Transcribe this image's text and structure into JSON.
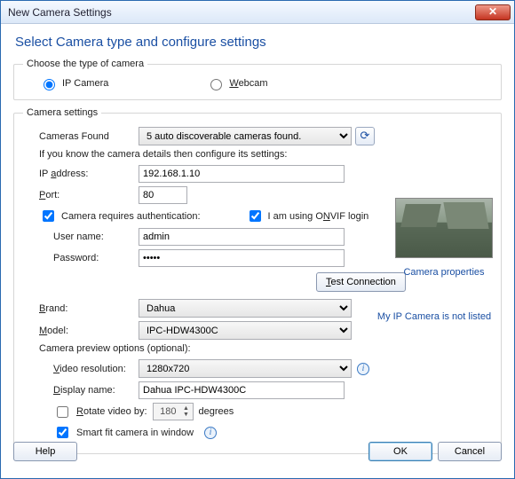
{
  "window": {
    "title": "New Camera Settings"
  },
  "heading": "Select Camera type and configure settings",
  "type_group": {
    "legend": "Choose the type of camera",
    "ip_label": "IP Camera",
    "webcam_label": "Webcam",
    "selected": "ip"
  },
  "settings_group": {
    "legend": "Camera settings",
    "cameras_found_label": "Cameras Found",
    "cameras_found_value": "5 auto discoverable cameras found.",
    "hint": "If you know the camera details then configure its settings:",
    "ip_label": "IP address:",
    "ip_value": "192.168.1.10",
    "port_label": "Port:",
    "port_value": "80",
    "auth_label": "Camera requires authentication:",
    "onvif_label": "I am using ONVIF login",
    "username_label": "User name:",
    "username_value": "admin",
    "password_label": "Password:",
    "password_value": "•••••",
    "test_label": "Test Connection",
    "brand_label": "Brand:",
    "brand_value": "Dahua",
    "model_label": "Model:",
    "model_value": "IPC-HDW4300C",
    "preview_heading": "Camera preview options (optional):",
    "video_res_label": "Video resolution:",
    "video_res_value": "1280x720",
    "display_name_label": "Display name:",
    "display_name_value": "Dahua IPC-HDW4300C",
    "rotate_label": "Rotate video by:",
    "rotate_value": "180",
    "rotate_suffix": "degrees",
    "smartfit_label": "Smart fit camera in window"
  },
  "side": {
    "camera_properties": "Camera properties",
    "not_listed": "My IP Camera is not listed"
  },
  "buttons": {
    "help": "Help",
    "ok": "OK",
    "cancel": "Cancel"
  }
}
